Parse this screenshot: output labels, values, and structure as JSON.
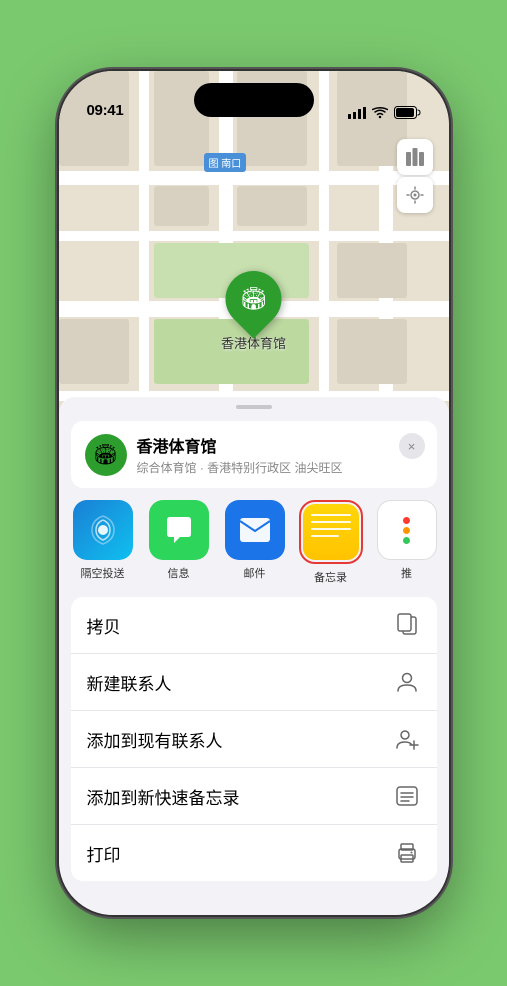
{
  "phone": {
    "time": "09:41",
    "status_icons": "●●● ▲ ▬"
  },
  "map": {
    "label_tag": "南口",
    "location_label_prefix": "图"
  },
  "venue": {
    "name": "香港体育馆",
    "subtitle": "综合体育馆 · 香港特别行政区 油尖旺区"
  },
  "share_items": [
    {
      "id": "airdrop",
      "label": "隔空投送",
      "type": "airdrop"
    },
    {
      "id": "messages",
      "label": "信息",
      "type": "messages"
    },
    {
      "id": "mail",
      "label": "邮件",
      "type": "mail"
    },
    {
      "id": "notes",
      "label": "备忘录",
      "type": "notes"
    },
    {
      "id": "more",
      "label": "推",
      "type": "more"
    }
  ],
  "actions": [
    {
      "id": "copy",
      "label": "拷贝",
      "icon": "copy"
    },
    {
      "id": "new-contact",
      "label": "新建联系人",
      "icon": "person"
    },
    {
      "id": "add-contact",
      "label": "添加到现有联系人",
      "icon": "person-add"
    },
    {
      "id": "quick-note",
      "label": "添加到新快速备忘录",
      "icon": "note"
    },
    {
      "id": "print",
      "label": "打印",
      "icon": "print"
    }
  ],
  "stadium_label": "香港体育馆",
  "close_label": "×"
}
